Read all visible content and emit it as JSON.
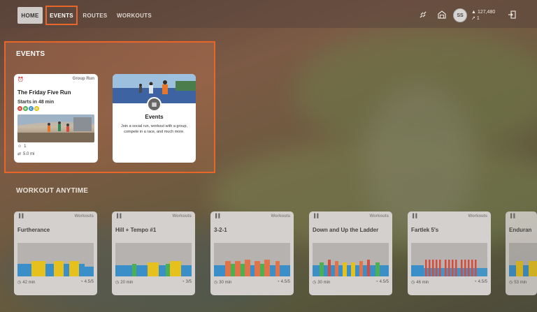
{
  "nav": {
    "home": "HOME",
    "events": "EVENTS",
    "routes": "ROUTES",
    "workouts": "WORKOUTS"
  },
  "user": {
    "initials": "SS",
    "xp": "127,480",
    "level": "1"
  },
  "colors": {
    "accent": "#e8662a",
    "blue": "#3a8fc8",
    "green": "#4caf50",
    "yellow": "#e6c11e",
    "orange": "#e0734a",
    "red": "#d84a3c"
  },
  "events_section": {
    "title": "EVENTS",
    "friday": {
      "tag": "Group Run",
      "title": "The Friday Five Run",
      "starts": "Starts in 48 min",
      "groups": [
        "A",
        "B",
        "C",
        "D"
      ],
      "participants": "1",
      "distance": "5.0 mi"
    },
    "events_card": {
      "title": "Events",
      "description": "Join a social run, workout with a group, compete in a race, and much more."
    }
  },
  "workouts_section": {
    "title": "WORKOUT ANYTIME",
    "cards": [
      {
        "tag": "Workouts",
        "name": "Furtherance",
        "duration": "42 min",
        "rating": "4.5/5"
      },
      {
        "tag": "Workouts",
        "name": "Hill + Tempo #1",
        "duration": "20 min",
        "rating": "3/5"
      },
      {
        "tag": "Workouts",
        "name": "3-2-1",
        "duration": "30 min",
        "rating": "4.5/5"
      },
      {
        "tag": "Workouts",
        "name": "Down and Up the Ladder",
        "duration": "30 min",
        "rating": "4.5/5"
      },
      {
        "tag": "Workouts",
        "name": "Fartlek 5's",
        "duration": "46 min",
        "rating": "4.5/5"
      },
      {
        "tag": "Workouts",
        "name": "Enduran",
        "duration": "53 min",
        "rating": ""
      }
    ]
  }
}
